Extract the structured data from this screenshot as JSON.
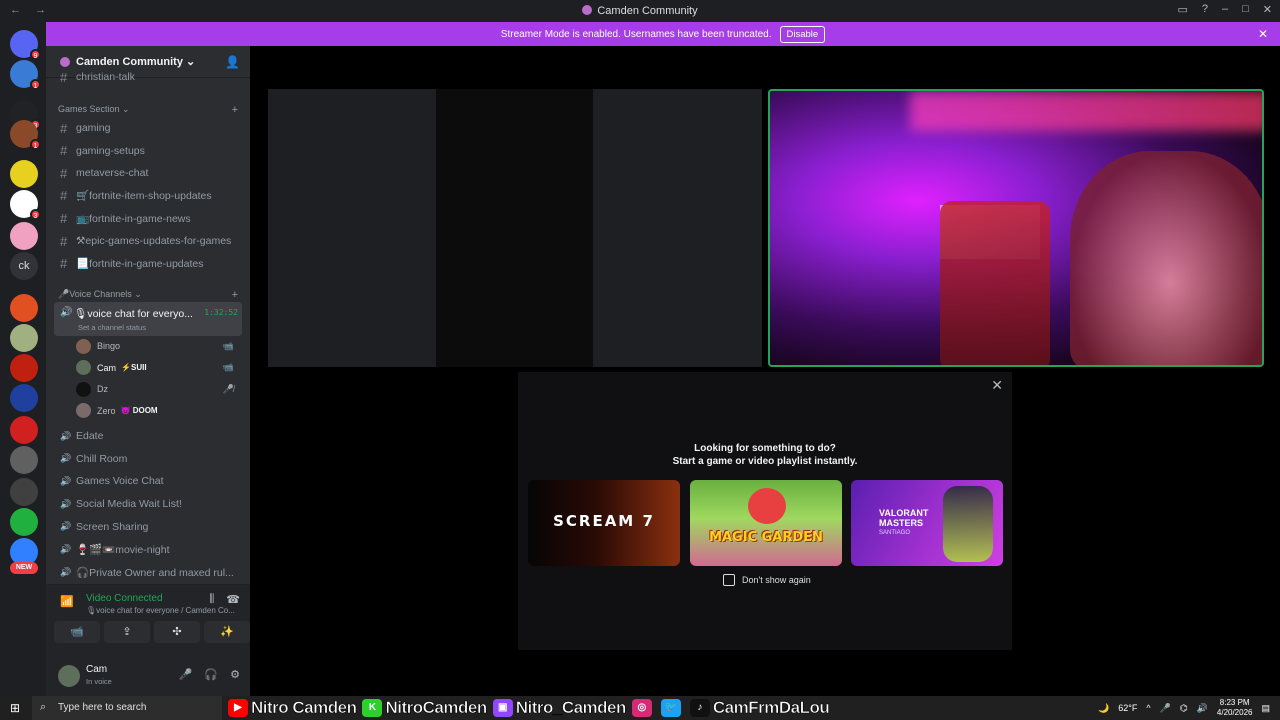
{
  "window": {
    "title": "Camden Community",
    "controls": [
      "▭",
      "?",
      "–",
      "□",
      "✕"
    ]
  },
  "banner": {
    "text": "Streamer Mode is enabled. Usernames have been truncated.",
    "button": "Disable",
    "close": "✕"
  },
  "servers": {
    "items": [
      {
        "name": "home",
        "badge": "9",
        "color": "#5865f2"
      },
      {
        "name": "server-1",
        "badge": "1",
        "color": "#3a7bd5"
      },
      {
        "name": "server-2",
        "badge": "3",
        "color": "#202225"
      },
      {
        "name": "server-3",
        "badge": "1",
        "color": "#8a4a2a"
      },
      {
        "name": "server-4",
        "badge": "",
        "color": "#e8d020"
      },
      {
        "name": "server-5",
        "badge": "3",
        "color": "#ffffff"
      },
      {
        "name": "server-6",
        "badge": "",
        "color": "#f0a0c0"
      },
      {
        "name": "server-7",
        "badge": "",
        "color": "#e05020"
      },
      {
        "name": "server-8",
        "badge": "",
        "color": "#a0b080"
      },
      {
        "name": "server-9",
        "badge": "",
        "color": "#c02010"
      },
      {
        "name": "server-10",
        "badge": "",
        "color": "#2040a0"
      },
      {
        "name": "server-11",
        "badge": "",
        "color": "#d02020"
      },
      {
        "name": "server-12",
        "badge": "",
        "color": "#606060"
      },
      {
        "name": "server-13",
        "badge": "",
        "color": "#404040"
      },
      {
        "name": "server-14",
        "badge": "",
        "color": "#20b040"
      },
      {
        "name": "server-15",
        "badge": "",
        "color": "#3080ff"
      }
    ],
    "text_server": "ck",
    "new_label": "NEW"
  },
  "guild": {
    "name": "Camden Community ⌄"
  },
  "channels": {
    "cut_top": "christian-talk",
    "games_section": "Games Section",
    "text_channels": [
      "gaming",
      "gaming-setups",
      "metaverse-chat",
      "🛒fortnite-item-shop-updates",
      "📺fortnite-in-game-news",
      "⚒epic-games-updates-for-games",
      "📃fortnite-in-game-updates"
    ],
    "voice_section": "🎤Voice Channels",
    "active_voice": {
      "name": "🎙voice chat for everyo...",
      "timer": "1:32:52",
      "status": "Set a channel status"
    },
    "voice_users": [
      {
        "name": "Bingo",
        "tag": "",
        "icon": "📹",
        "color": "#806050"
      },
      {
        "name": "Cam",
        "tag": "⚡SUII",
        "icon": "📹",
        "color": "#5d6e5a"
      },
      {
        "name": "Dz",
        "tag": "",
        "icon": "🎤̸",
        "color": "#111111"
      },
      {
        "name": "Zero",
        "tag": "😈 DOOM",
        "icon": "",
        "color": "#7a6a6a"
      }
    ],
    "voice_channels": [
      "Edate",
      "Chill Room",
      "Games Voice Chat",
      "Social Media Wait List!",
      "Screen Sharing",
      "🍷🎬📼movie-night",
      "🎧Private Owner and maxed rul..."
    ]
  },
  "voice_panel": {
    "state": "Video Connected",
    "channel": "🎙voice chat for everyone / Camden Co...",
    "buttons": [
      "📹",
      "⇪",
      "✣",
      "✨"
    ]
  },
  "user_panel": {
    "name": "Cam",
    "status": "In voice"
  },
  "modal": {
    "close": "✕",
    "line1": "Looking for something to do?",
    "line2": "Start a game or video playlist instantly.",
    "cards": [
      "SCREAM 7",
      "MAGIC GARDEN",
      "VALORANT MASTERS"
    ],
    "card3_sub": "SANTIAGO",
    "checkbox_label": "Don't show again"
  },
  "taskbar": {
    "search_placeholder": "Type here to search",
    "socials": [
      {
        "icon": "▶",
        "color": "#ff0000",
        "text": "Nitro Camden"
      },
      {
        "icon": "K",
        "color": "#2ed02e",
        "text": "NitroCamden"
      },
      {
        "icon": "▣",
        "color": "#9146ff",
        "text": "Nitro_Camden"
      },
      {
        "icon": "◎",
        "color": "#d62976",
        "text": ""
      },
      {
        "icon": "🐦",
        "color": "#1da1f2",
        "text": ""
      },
      {
        "icon": "♪",
        "color": "#111111",
        "text": "CamFrmDaLou"
      }
    ],
    "weather": "62°F",
    "time": "8:23 PM",
    "date": "4/20/2026"
  }
}
